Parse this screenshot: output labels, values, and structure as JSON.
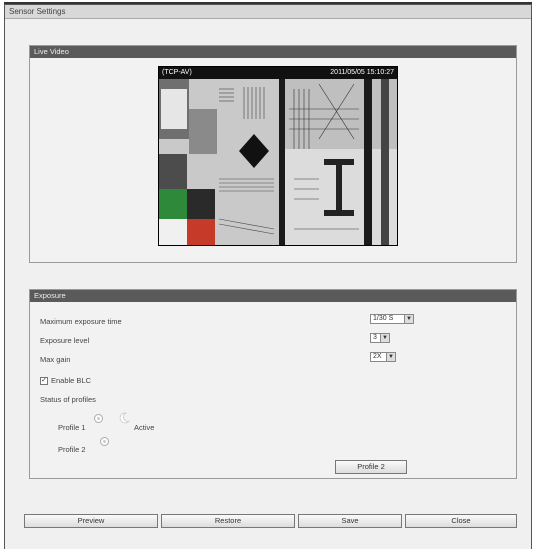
{
  "window": {
    "title": "Sensor Settings"
  },
  "live_video": {
    "section_title": "Live Video",
    "protocol": "(TCP-AV)",
    "timestamp": "2011/05/05 15:10:27"
  },
  "exposure": {
    "section_title": "Exposure",
    "max_exposure_time": {
      "label": "Maximum exposure time",
      "value": "1/30 S"
    },
    "exposure_level": {
      "label": "Exposure level",
      "value": "3"
    },
    "max_gain": {
      "label": "Max gain",
      "value": "2X"
    },
    "enable_blc": {
      "label": "Enable BLC",
      "checked": true
    },
    "status_of_profiles": {
      "label": "Status of profiles",
      "profile1": {
        "label": "Profile 1",
        "status": "Active"
      },
      "profile2": {
        "label": "Profile 2"
      }
    },
    "profile2_button": "Profile 2"
  },
  "buttons": {
    "preview": "Preview",
    "restore": "Restore",
    "save": "Save",
    "close": "Close"
  }
}
